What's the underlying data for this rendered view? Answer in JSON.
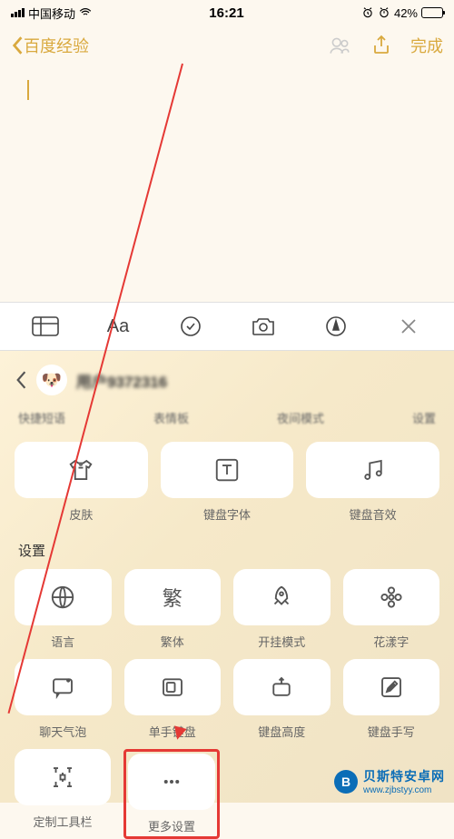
{
  "status": {
    "carrier": "中国移动",
    "time": "16:21",
    "battery_pct": "42%"
  },
  "nav": {
    "back_label": "百度经验",
    "done_label": "完成"
  },
  "toolbar": {
    "aa": "Aa"
  },
  "panel": {
    "username": "用户9372316",
    "cut_row": [
      "快捷短语",
      "表情板",
      "夜间模式",
      "设置"
    ],
    "row1": [
      {
        "label": "皮肤",
        "icon": "shirt"
      },
      {
        "label": "键盘字体",
        "icon": "text-T"
      },
      {
        "label": "键盘音效",
        "icon": "music-note"
      }
    ],
    "section_title": "设置",
    "row2": [
      {
        "label": "语言",
        "icon": "globe"
      },
      {
        "label": "繁体",
        "icon": "fan-char"
      },
      {
        "label": "开挂模式",
        "icon": "rocket"
      },
      {
        "label": "花漾字",
        "icon": "flower"
      }
    ],
    "row3": [
      {
        "label": "聊天气泡",
        "icon": "bubble"
      },
      {
        "label": "单手键盘",
        "icon": "single-hand"
      },
      {
        "label": "键盘高度",
        "icon": "height"
      },
      {
        "label": "键盘手写",
        "icon": "handwrite"
      }
    ],
    "row4": [
      {
        "label": "定制工具栏",
        "icon": "custom-toolbar"
      },
      {
        "label": "更多设置",
        "icon": "dots"
      }
    ]
  },
  "watermark": {
    "cn": "贝斯特安卓网",
    "url": "www.zjbstyy.com"
  }
}
